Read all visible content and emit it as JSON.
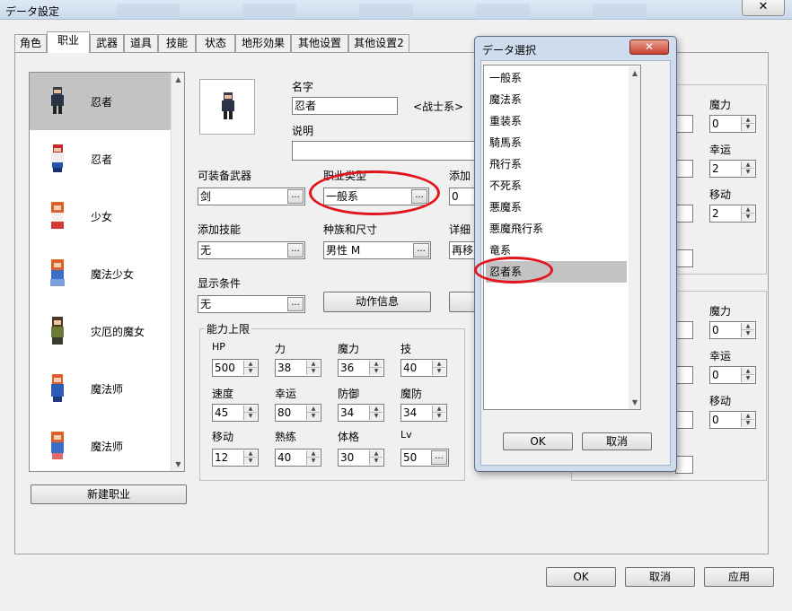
{
  "window": {
    "title": "データ設定",
    "close_glyph": "✕"
  },
  "tabs": [
    "角色",
    "职业",
    "武器",
    "道具",
    "技能",
    "状态",
    "地形効果",
    "其他设置",
    "其他设置2"
  ],
  "active_tab_index": 1,
  "class_list": [
    {
      "name": "忍者",
      "selected": true
    },
    {
      "name": "忍者",
      "selected": false
    },
    {
      "name": "少女",
      "selected": false
    },
    {
      "name": "魔法少女",
      "selected": false
    },
    {
      "name": "灾厄的魔女",
      "selected": false
    },
    {
      "name": "魔法师",
      "selected": false
    },
    {
      "name": "魔法师",
      "selected": false
    }
  ],
  "new_class_button": "新建职业",
  "form": {
    "name_label": "名字",
    "name_value": "忍者",
    "class_type_hint": "<战士系>",
    "desc_label": "说明",
    "weapon_label": "可装备武器",
    "weapon_value": "剑",
    "class_type_label": "职业类型",
    "class_type_value": "一般系",
    "add_label_partial": "添加",
    "add_value_partial": "0",
    "add_skill_label": "添加技能",
    "add_skill_value": "无",
    "race_label": "种族和尺寸",
    "race_value": "男性 M",
    "detail_label_partial": "详细",
    "detail_value_partial": "再移",
    "display_cond_label": "显示条件",
    "display_cond_value": "无",
    "action_info_button": "动作信息",
    "ellipsis": "..."
  },
  "ability_cap": {
    "title": "能力上限",
    "stats": [
      {
        "label": "HP",
        "value": "500"
      },
      {
        "label": "力",
        "value": "38"
      },
      {
        "label": "魔力",
        "value": "36"
      },
      {
        "label": "技",
        "value": "40"
      },
      {
        "label": "速度",
        "value": "45"
      },
      {
        "label": "幸运",
        "value": "80"
      },
      {
        "label": "防御",
        "value": "34"
      },
      {
        "label": "魔防",
        "value": "34"
      },
      {
        "label": "移动",
        "value": "12"
      },
      {
        "label": "熟练",
        "value": "40"
      },
      {
        "label": "体格",
        "value": "30"
      },
      {
        "label": "Lv",
        "value": "50"
      }
    ]
  },
  "right_panel_top": [
    {
      "label": "魔力",
      "value": "0"
    },
    {
      "label": "幸运",
      "value": "2"
    },
    {
      "label": "移动",
      "value": "2"
    }
  ],
  "right_panel_bottom": [
    {
      "label": "魔力",
      "value": "0"
    },
    {
      "label": "幸运",
      "value": "0"
    },
    {
      "label": "移动",
      "value": "0"
    }
  ],
  "bottom_buttons": {
    "ok": "OK",
    "cancel": "取消",
    "apply": "应用"
  },
  "popup": {
    "title": "データ選択",
    "close_glyph": "✕",
    "items": [
      "一般系",
      "魔法系",
      "重装系",
      "騎馬系",
      "飛行系",
      "不死系",
      "悪魔系",
      "悪魔飛行系",
      "竜系",
      "忍者系"
    ],
    "selected_index": 9,
    "ok": "OK",
    "cancel": "取消"
  },
  "colors": {
    "highlight_oval": "#e2141c",
    "selection": "#c3c3c3"
  }
}
